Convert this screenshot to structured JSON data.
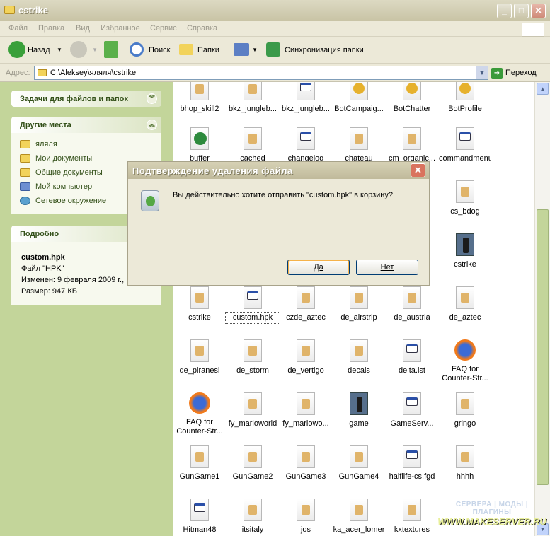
{
  "window": {
    "title": "cstrike"
  },
  "menu": [
    "Файл",
    "Правка",
    "Вид",
    "Избранное",
    "Сервис",
    "Справка"
  ],
  "toolbar": {
    "back": "Назад",
    "search": "Поиск",
    "folders": "Папки",
    "sync": "Синхронизация папки"
  },
  "address": {
    "label": "Адрес:",
    "value": "C:\\Aleksey\\яляля\\cstrike",
    "go": "Переход"
  },
  "tasks": {
    "panel1_title": "Задачи для файлов и папок",
    "places_title": "Другие места",
    "places": [
      "яляля",
      "Мои документы",
      "Общие документы",
      "Мой компьютер",
      "Сетевое окружение"
    ],
    "details_title": "Подробно",
    "details_name": "custom.hpk",
    "details_type": "Файл \"HPK\"",
    "details_modified": "Изменен: 9 февраля 2009 г., ...",
    "details_size": "Размер: 947 КБ"
  },
  "files": [
    "bhop_skill2",
    "bkz_jungleb...",
    "bkz_jungleb...",
    "BotCampaig...",
    "BotChatter",
    "BotProfile",
    "buffer",
    "cached",
    "changelog",
    "chateau",
    "cm_organic...",
    "commandmenu",
    "cs_bdog",
    "cstrike",
    "cstrike",
    "custom.hpk",
    "czde_aztec",
    "de_airstrip",
    "de_austria",
    "de_aztec",
    "de_piranesi",
    "de_storm",
    "de_vertigo",
    "decals",
    "delta.lst",
    "FAQ for Counter-Str...",
    "FAQ for Counter-Str...",
    "fy_marioworld",
    "fy_mariowo...",
    "game",
    "GameServ...",
    "gringo",
    "GunGame1",
    "GunGame2",
    "GunGame3",
    "GunGame4",
    "halflife-cs.fgd",
    "hhhh",
    "Hitman48",
    "itsitaly",
    "jos",
    "ka_acer_lomer",
    "kxtextures"
  ],
  "dialog": {
    "title": "Подтверждение удаления файла",
    "message": "Вы действительно хотите отправить \"custom.hpk\" в корзину?",
    "yes": "Да",
    "no": "Нет"
  },
  "watermark": {
    "line1": "СЕРВЕРА | МОДЫ | ПЛАГИНЫ",
    "line2": "WWW.MAKESERVER.RU"
  }
}
